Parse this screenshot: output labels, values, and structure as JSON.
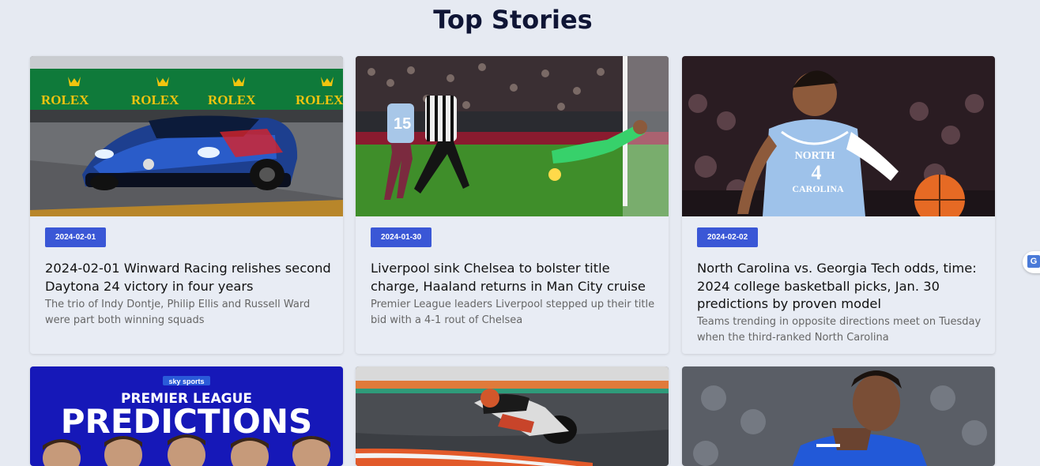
{
  "page": {
    "title": "Top Stories"
  },
  "stories": [
    {
      "date": "2024-02-01",
      "headline": "2024-02-01 Winward Racing relishes second Daytona 24 victory in four years",
      "summary": "The trio of Indy Dontje, Philip Ellis and Russell Ward were part both winning squads",
      "image_text": [
        "ROLEX",
        "ROLEX",
        "ROLEX",
        "ROLEX"
      ]
    },
    {
      "date": "2024-01-30",
      "headline": "Liverpool sink Chelsea to bolster title charge, Haaland returns in Man City cruise",
      "summary": "Premier League leaders Liverpool stepped up their title bid with a 4-1 rout of Chelsea",
      "image_text": [
        "15"
      ]
    },
    {
      "date": "2024-02-02",
      "headline": "North Carolina vs. Georgia Tech odds, time: 2024 college basketball picks, Jan. 30 predictions by proven model",
      "summary": "Teams trending in opposite directions meet on Tuesday when the third-ranked North Carolina",
      "image_text": [
        "NORTH",
        "4",
        "CAROLINA"
      ]
    },
    {
      "image_text": [
        "sky sports",
        "PREMIER LEAGUE",
        "PREDICTIONS"
      ]
    },
    {
      "image_text": []
    },
    {
      "image_text": []
    }
  ],
  "translate_widget": {
    "icon": "google-translate-icon",
    "glyph": "G"
  }
}
